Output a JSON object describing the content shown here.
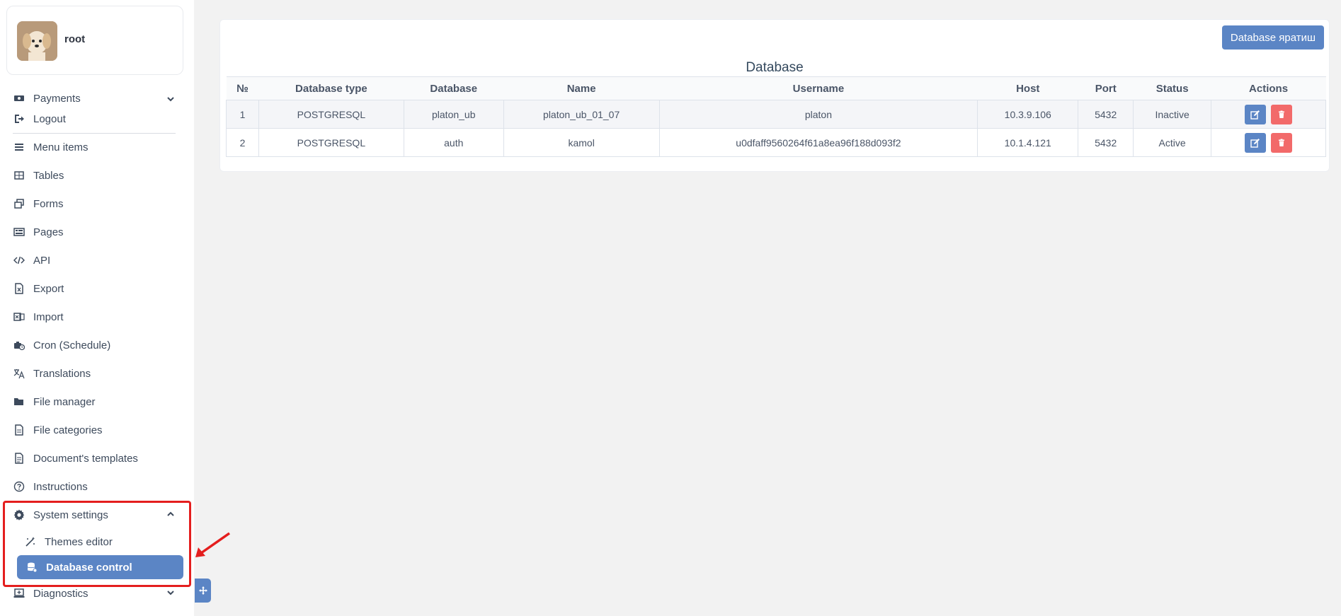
{
  "profile": {
    "name": "root"
  },
  "sidebar": {
    "items": [
      {
        "label": "Payments",
        "icon": "money-icon"
      },
      {
        "label": "Logout",
        "icon": "logout-icon"
      },
      {
        "label": "Menu items",
        "icon": "list-icon"
      },
      {
        "label": "Tables",
        "icon": "table-icon"
      },
      {
        "label": "Forms",
        "icon": "forms-icon"
      },
      {
        "label": "Pages",
        "icon": "pages-icon"
      },
      {
        "label": "API",
        "icon": "code-icon"
      },
      {
        "label": "Export",
        "icon": "export-icon"
      },
      {
        "label": "Import",
        "icon": "import-icon"
      },
      {
        "label": "Cron (Schedule)",
        "icon": "cron-icon"
      },
      {
        "label": "Translations",
        "icon": "translate-icon"
      },
      {
        "label": "File manager",
        "icon": "folder-icon"
      },
      {
        "label": "File categories",
        "icon": "file-icon"
      },
      {
        "label": "Document's templates",
        "icon": "document-icon"
      },
      {
        "label": "Instructions",
        "icon": "question-icon"
      },
      {
        "label": "System settings",
        "icon": "gear-icon"
      },
      {
        "label": "Themes editor",
        "icon": "magic-icon"
      },
      {
        "label": "Database control",
        "icon": "database-icon"
      },
      {
        "label": "Diagnostics",
        "icon": "laptop-icon"
      }
    ]
  },
  "main": {
    "add_button": "Database яратиш",
    "title": "Database",
    "columns": [
      "№",
      "Database type",
      "Database",
      "Name",
      "Username",
      "Host",
      "Port",
      "Status",
      "Actions"
    ],
    "rows": [
      {
        "no": "1",
        "type": "POSTGRESQL",
        "database": "platon_ub",
        "name": "platon_ub_01_07",
        "username": "platon",
        "host": "10.3.9.106",
        "port": "5432",
        "status": "Inactive"
      },
      {
        "no": "2",
        "type": "POSTGRESQL",
        "database": "auth",
        "name": "kamol",
        "username": "u0dfaff9560264f61a8ea96f188d093f2",
        "host": "10.1.4.121",
        "port": "5432",
        "status": "Active"
      }
    ]
  },
  "colors": {
    "accent": "#5b85c5",
    "danger": "#f26a6a",
    "highlight": "#e41e1e"
  }
}
